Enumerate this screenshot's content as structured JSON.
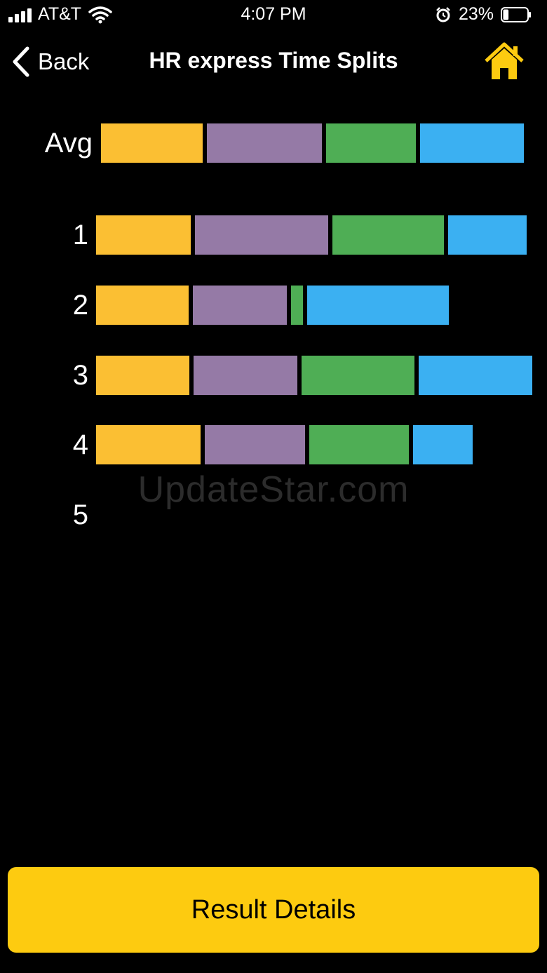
{
  "status_bar": {
    "carrier": "AT&T",
    "time": "4:07 PM",
    "battery_percent": "23%",
    "battery_level": 0.23,
    "icons": [
      "signal-icon",
      "wifi-icon",
      "alarm-icon",
      "battery-icon"
    ]
  },
  "nav": {
    "back_label": "Back",
    "title": "HR express Time Splits",
    "home_icon": "home-icon"
  },
  "colors": {
    "accent": "#fdcb10",
    "segment_colors": [
      "#fbbf33",
      "#957aa6",
      "#4fae55",
      "#3bb0f2"
    ]
  },
  "rows": [
    {
      "label": "Avg",
      "segments": [
        145,
        164,
        128,
        148
      ]
    },
    {
      "label": "1",
      "segments": [
        135,
        190,
        159,
        112
      ]
    },
    {
      "label": "2",
      "segments": [
        132,
        134,
        17,
        202
      ]
    },
    {
      "label": "3",
      "segments": [
        133,
        148,
        161,
        162
      ]
    },
    {
      "label": "4",
      "segments": [
        149,
        143,
        142,
        85
      ]
    },
    {
      "label": "5",
      "segments": []
    }
  ],
  "watermark": "UpdateStar.com",
  "footer": {
    "result_details_label": "Result Details"
  }
}
